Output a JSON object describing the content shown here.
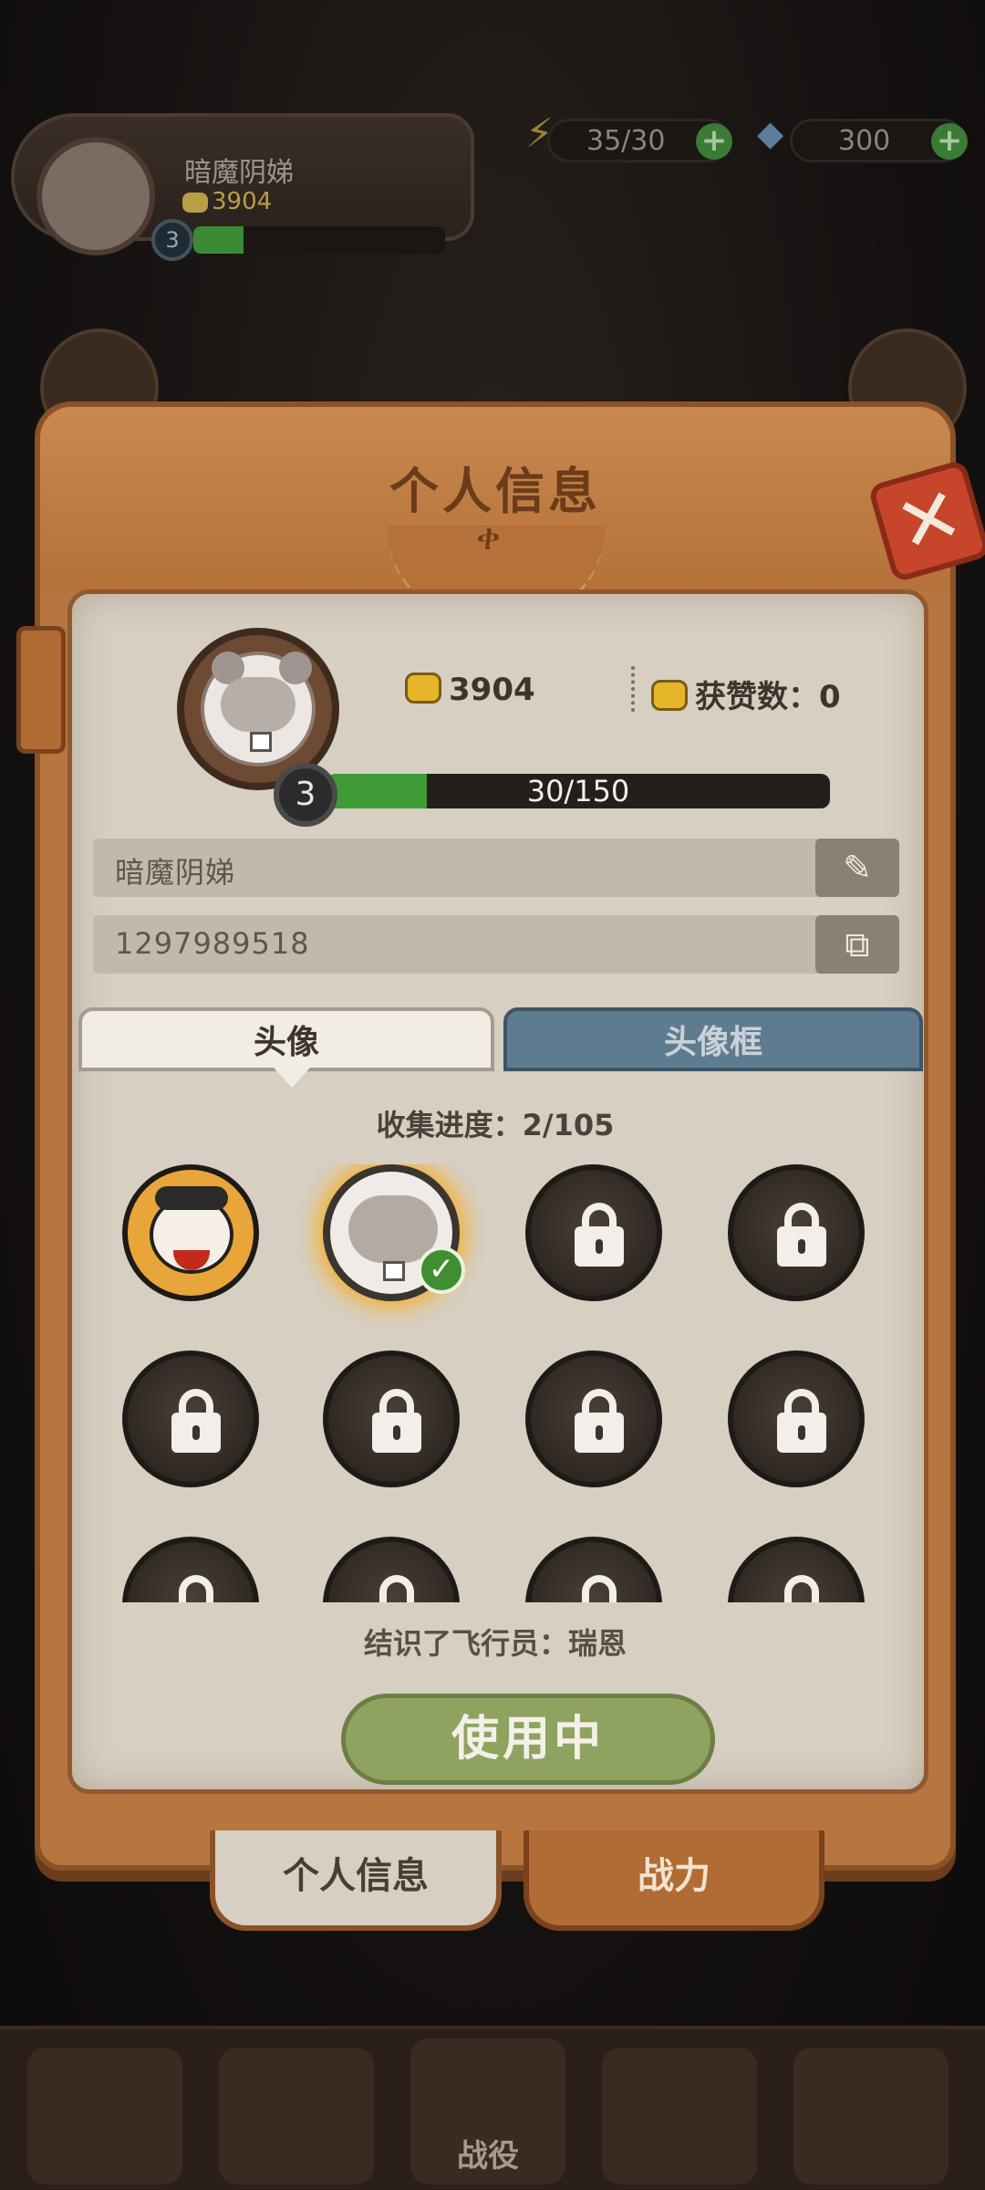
{
  "hud": {
    "player_name": "暗魔阴娣",
    "score": "3904",
    "level": "3",
    "energy": "35/30",
    "gems": "300",
    "plus_label": "+",
    "xp_fraction": 0.2
  },
  "dialog": {
    "title": "个人信息",
    "close_label": "✕",
    "profile": {
      "score": "3904",
      "likes_label": "获赞数：",
      "likes_value": "0",
      "level": "3",
      "xp_text": "30/150",
      "xp_current": 30,
      "xp_max": 150
    },
    "name_field": {
      "value": "暗魔阴娣",
      "button_icon": "edit-icon"
    },
    "id_field": {
      "value": "1297989518",
      "button_icon": "copy-icon"
    },
    "tabs": [
      {
        "label": "头像",
        "active": true
      },
      {
        "label": "头像框",
        "active": false
      }
    ],
    "collection_text": "收集进度：2/105",
    "avatars": [
      {
        "type": "pilot",
        "unlocked": true,
        "selected": false
      },
      {
        "type": "squirrel",
        "unlocked": true,
        "selected": true
      },
      {
        "type": "locked",
        "unlocked": false
      },
      {
        "type": "locked",
        "unlocked": false
      },
      {
        "type": "locked",
        "unlocked": false
      },
      {
        "type": "locked",
        "unlocked": false
      },
      {
        "type": "locked",
        "unlocked": false
      },
      {
        "type": "locked",
        "unlocked": false
      },
      {
        "type": "locked",
        "unlocked": false
      },
      {
        "type": "locked",
        "unlocked": false
      },
      {
        "type": "locked",
        "unlocked": false
      },
      {
        "type": "locked",
        "unlocked": false
      }
    ],
    "avatar_description": "结识了飞行员：瑞恩",
    "use_button": "使用中",
    "bottom_tabs": [
      {
        "label": "个人信息",
        "active": true
      },
      {
        "label": "战力",
        "active": false
      }
    ]
  },
  "bottom_nav": {
    "center_label": "战役"
  },
  "colors": {
    "accent_green": "#3f9b36",
    "leather": "#b7763f",
    "paper": "#d7cfc2",
    "close_red": "#c7452a"
  }
}
